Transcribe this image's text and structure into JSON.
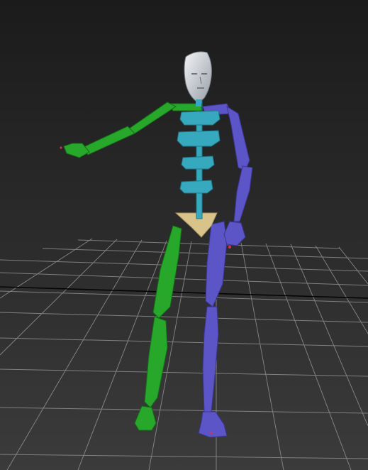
{
  "viewport": {
    "background_top": "#1b1b1b",
    "background_bottom": "#3b3b3b",
    "grid_color": "#8e8e8e",
    "grid_highlight_color": "#000000"
  },
  "rig": {
    "left_side_color": "#27a82a",
    "right_side_color": "#5c55c8",
    "spine_color": "#37a9bf",
    "head_color": "#c8ccd0",
    "pelvis_color": "#d8c48a",
    "marker_color": "#d8324a"
  }
}
